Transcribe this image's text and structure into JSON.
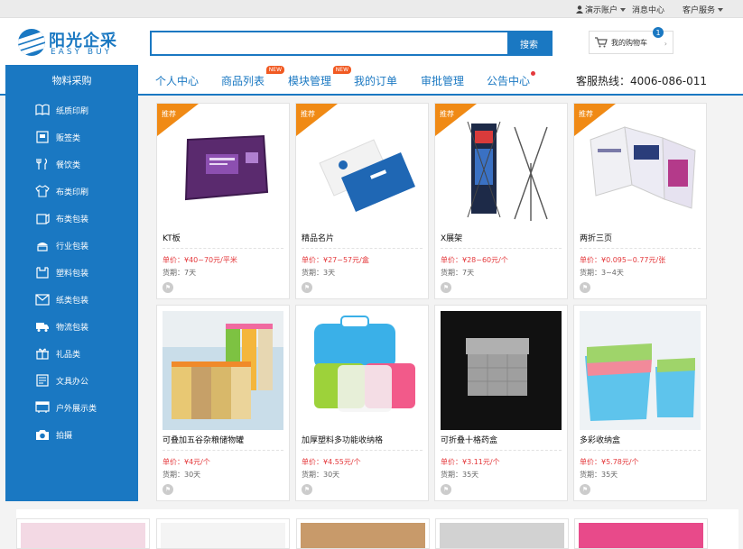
{
  "topbar": {
    "account": "演示账户",
    "messages": "消息中心",
    "service": "客户服务"
  },
  "logo": {
    "cn": "阳光企采",
    "en": "EASY BUY"
  },
  "search": {
    "placeholder": "",
    "button": "搜索"
  },
  "cart": {
    "label": "我的购物车",
    "count": "1"
  },
  "nav": {
    "category_title": "物料采购",
    "items": [
      {
        "label": "个人中心",
        "badge": ""
      },
      {
        "label": "商品列表",
        "badge": "NEW"
      },
      {
        "label": "模块管理",
        "badge": "NEW"
      },
      {
        "label": "我的订单",
        "badge": ""
      },
      {
        "label": "审批管理",
        "badge": ""
      },
      {
        "label": "公告中心",
        "badge": "dot"
      }
    ],
    "hotline": "客服热线：4006-086-011"
  },
  "sidebar": {
    "items": [
      {
        "label": "纸质印刷",
        "icon": "book-icon"
      },
      {
        "label": "贩签类",
        "icon": "badge-icon"
      },
      {
        "label": "餐饮类",
        "icon": "cutlery-icon"
      },
      {
        "label": "布类印刷",
        "icon": "shirt-icon"
      },
      {
        "label": "布类包装",
        "icon": "bag-icon"
      },
      {
        "label": "行业包装",
        "icon": "cake-icon"
      },
      {
        "label": "塑料包装",
        "icon": "box-icon"
      },
      {
        "label": "纸类包装",
        "icon": "envelope-icon"
      },
      {
        "label": "物流包装",
        "icon": "truck-icon"
      },
      {
        "label": "礼品类",
        "icon": "gift-icon"
      },
      {
        "label": "文具办公",
        "icon": "document-icon"
      },
      {
        "label": "户外展示类",
        "icon": "display-icon"
      },
      {
        "label": "拍摄",
        "icon": "camera-icon"
      }
    ]
  },
  "products": [
    {
      "name": "KT板",
      "price": "单价：¥40~70元/平米",
      "lead": "货期：7天",
      "tag": "推荐"
    },
    {
      "name": "精品名片",
      "price": "单价：¥27~57元/盒",
      "lead": "货期：3天",
      "tag": "推荐"
    },
    {
      "name": "X展架",
      "price": "单价：¥28~60元/个",
      "lead": "货期：7天",
      "tag": "推荐"
    },
    {
      "name": "两折三页",
      "price": "单价：¥0.095~0.77元/张",
      "lead": "货期：3~4天",
      "tag": "推荐"
    },
    {
      "name": "可叠加五谷杂粮储物罐",
      "price": "单价：¥4元/个",
      "lead": "货期：30天",
      "tag": ""
    },
    {
      "name": "加厚塑料多功能收纳格",
      "price": "单价：¥4.55元/个",
      "lead": "货期：30天",
      "tag": ""
    },
    {
      "name": "可折叠十格药盒",
      "price": "单价：¥3.11元/个",
      "lead": "货期：35天",
      "tag": ""
    },
    {
      "name": "多彩收纳盒",
      "price": "单价：¥5.78元/个",
      "lead": "货期：35天",
      "tag": ""
    }
  ]
}
